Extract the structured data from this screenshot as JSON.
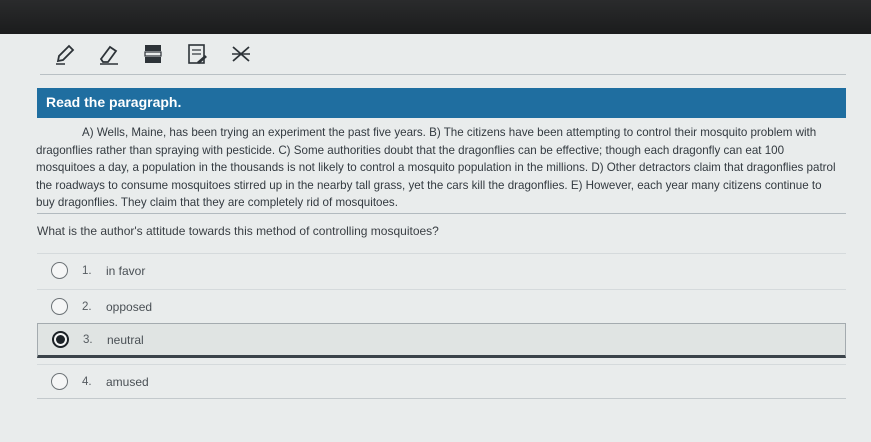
{
  "toolbar": {
    "tools": [
      "pencil-icon",
      "eraser-icon",
      "highlighter-icon",
      "notepad-icon",
      "eliminate-icon"
    ]
  },
  "header": {
    "title": "Read the paragraph."
  },
  "passage": {
    "text": "A) Wells, Maine, has been trying an experiment the past five years. B) The citizens have been attempting to control their mosquito problem with dragonflies rather than spraying with pesticide. C) Some authorities doubt that the dragonflies can be effective; though each dragonfly can eat 100 mosquitoes a day, a population in the thousands is not likely to control a mosquito population in the millions. D) Other detractors claim that dragonflies patrol the roadways to consume mosquitoes stirred up in the nearby tall grass, yet the cars kill the dragonflies. E) However, each year many citizens continue to buy dragonflies. They claim that they are completely rid of mosquitoes."
  },
  "question": {
    "text": "What is the author's attitude towards this method of controlling mosquitoes?"
  },
  "options": [
    {
      "num": "1.",
      "label": "in favor",
      "selected": false
    },
    {
      "num": "2.",
      "label": "opposed",
      "selected": false
    },
    {
      "num": "3.",
      "label": "neutral",
      "selected": true
    },
    {
      "num": "4.",
      "label": "amused",
      "selected": false
    }
  ],
  "colors": {
    "header_bg": "#1f6ea0",
    "selected_radio": "#1c2227"
  }
}
